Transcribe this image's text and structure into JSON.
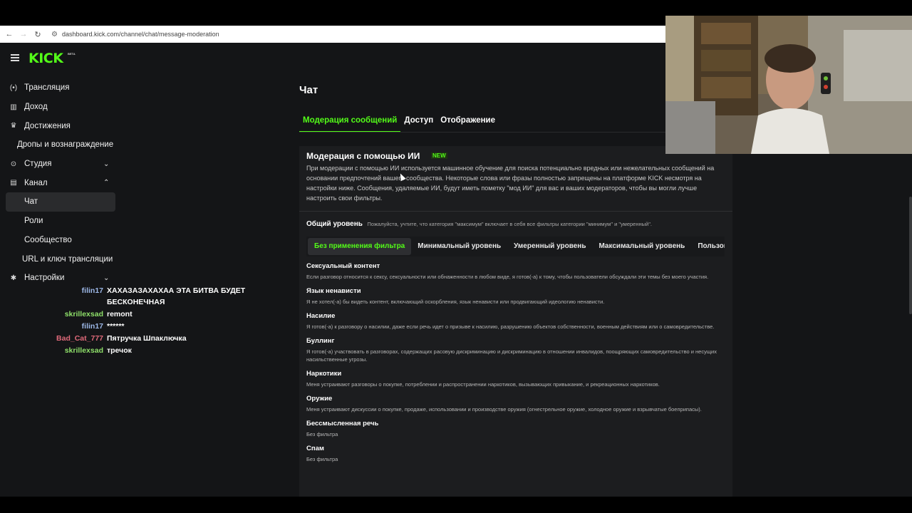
{
  "browser": {
    "back": "←",
    "forward": "→",
    "reload": "↻",
    "url": "dashboard.kick.com/channel/chat/message-moderation"
  },
  "header": {
    "logo": "KICK",
    "logo_badge": "BETA"
  },
  "sidebar": {
    "items": [
      {
        "icon": "(•)",
        "label": "Трансляция"
      },
      {
        "icon": "▥",
        "label": "Доход"
      },
      {
        "icon": "♛",
        "label": "Достижения"
      },
      {
        "icon": "",
        "label": "Дропы и вознаграждение"
      },
      {
        "icon": "⊙",
        "label": "Студия",
        "chevron": "⌄"
      },
      {
        "icon": "▤",
        "label": "Канал",
        "chevron": "⌃"
      },
      {
        "icon": "",
        "label": "Чат"
      },
      {
        "icon": "",
        "label": "Роли"
      },
      {
        "icon": "",
        "label": "Сообщество"
      },
      {
        "icon": "",
        "label": "URL и ключ трансляции"
      },
      {
        "icon": "✱",
        "label": "Настройки",
        "chevron": "⌄"
      }
    ]
  },
  "chat": {
    "messages": [
      {
        "user": "filin17",
        "text": "ХАХАЗАЗАХАХАА ЭТА БИТВА БУДЕТ БЕСКОНЕЧНАЯ",
        "color": "#9db8e8"
      },
      {
        "user": "skrillexsad",
        "text": "remont",
        "color": "#8fe06a"
      },
      {
        "user": "filin17",
        "text": "******",
        "color": "#9db8e8"
      },
      {
        "user": "Bad_Cat_777",
        "text": "Пятручка Шпаключка",
        "color": "#e06a7a"
      },
      {
        "user": "skrillexsad",
        "text": "тречок",
        "color": "#8fe06a"
      }
    ]
  },
  "main": {
    "title": "Чат",
    "tabs": [
      "Модерация сообщений",
      "Доступ",
      "Отображение"
    ],
    "ai": {
      "title": "Модерация с помощью ИИ",
      "badge": "NEW",
      "description": "При модерации с помощью ИИ используется машинное обучение для поиска потенциально вредных или нежелательных сообщений на основании предпочтений вашего сообщества. Некоторые слова или фразы полностью запрещены на платформе KICK несмотря на настройки ниже. Сообщения, удаляемые ИИ, будут иметь пометку \"мод ИИ\" для вас и ваших модераторов, чтобы вы могли лучше настроить свои фильтры.",
      "level_label": "Общий уровень",
      "level_note": "Пожалуйста, учтите, что категория \"максимум\" включает в себя все фильтры категории \"минимум\" и \"умеренный\".",
      "filter_tabs": [
        "Без применения фильтра",
        "Минимальный уровень",
        "Умеренный уровень",
        "Максимальный уровень",
        "Пользовательский"
      ],
      "categories": [
        {
          "title": "Сексуальный контент",
          "desc": "Если разговор относится к сексу, сексуальности или обнаженности в любом виде, я готов(-а) к тому, чтобы пользователи обсуждали эти темы без моего участия."
        },
        {
          "title": "Язык ненависти",
          "desc": "Я не хотел(-а) бы видеть контент, включающий оскорбления, язык ненависти или продвигающий идеологию ненависти."
        },
        {
          "title": "Насилие",
          "desc": "Я готов(-а) к разговору о насилии, даже если речь идет о призыве к насилию, разрушению объектов собственности, военным действиям или о самовредительстве."
        },
        {
          "title": "Буллинг",
          "desc": "Я готов(-а) участвовать в разговорах, содержащих расовую дискриминацию и дискриминацию в отношении инвалидов, поощряющих самовредительство и несущих насильственные угрозы."
        },
        {
          "title": "Наркотики",
          "desc": "Меня устраивают разговоры о покупке, потреблении и распространении наркотиков, вызывающих привыкание, и рекреационных наркотиков."
        },
        {
          "title": "Оружие",
          "desc": "Меня устраивают дискуссии о покупке, продаже, использовании и производстве оружия (огнестрельное оружие, холодное оружие и взрывчатые боеприпасы)."
        },
        {
          "title": "Бессмысленная речь",
          "desc": "Без фильтра"
        },
        {
          "title": "Спам",
          "desc": "Без фильтра"
        }
      ]
    }
  },
  "colors": {
    "accent": "#53fc18",
    "background": "#141517",
    "card": "#1c1d1f"
  }
}
